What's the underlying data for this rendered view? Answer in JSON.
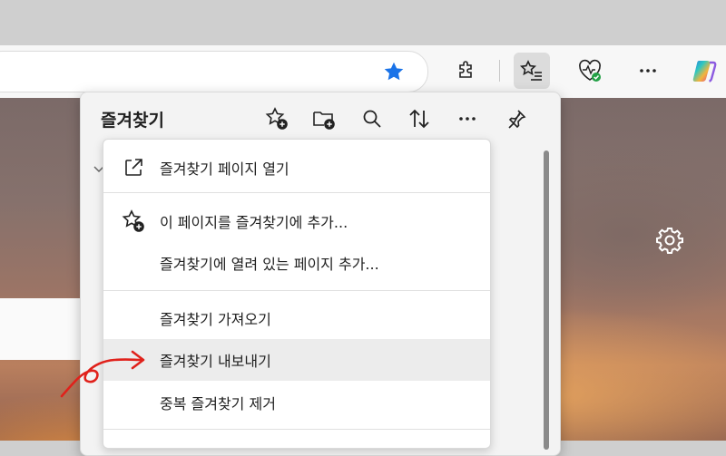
{
  "favorites": {
    "title": "즐겨찾기"
  },
  "menu": {
    "items": [
      {
        "label": "즐겨찾기 페이지 열기"
      },
      {
        "label": "이 페이지를 즐겨찾기에 추가..."
      },
      {
        "label": "즐겨찾기에 열려 있는 페이지 추가..."
      },
      {
        "label": "즐겨찾기 가져오기"
      },
      {
        "label": "즐겨찾기 내보내기"
      },
      {
        "label": "중복 즐겨찾기 제거"
      }
    ],
    "highlighted": "즐겨찾기 내보내기"
  },
  "icons": {
    "address_bar": [
      "favorite-star-icon"
    ],
    "toolbar": [
      "extensions-icon",
      "favorites-icon",
      "browser-essentials-icon",
      "more-icon",
      "copilot-icon"
    ],
    "panel": [
      "add-favorite-icon",
      "add-folder-icon",
      "search-icon",
      "sort-icon",
      "more-options-icon",
      "pin-icon"
    ],
    "page": [
      "settings-gear-icon"
    ]
  },
  "colors": {
    "accent_blue": "#1a73e8",
    "annotation_red": "#e0211b",
    "status_green": "#22a045"
  }
}
